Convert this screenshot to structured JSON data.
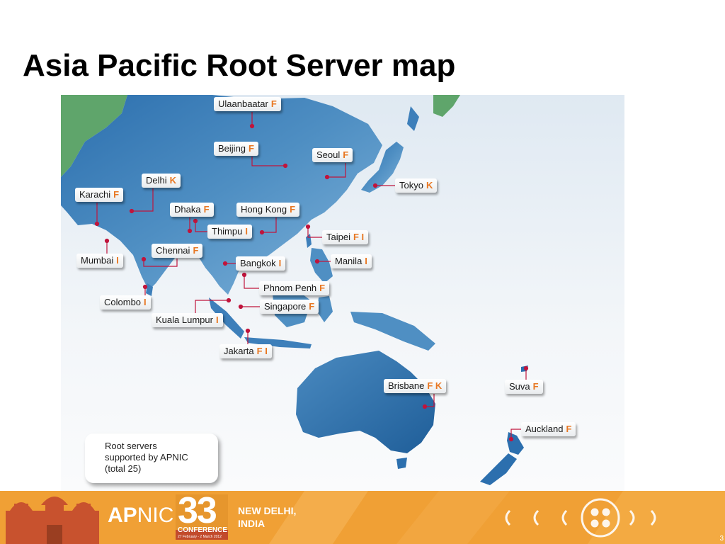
{
  "slide": {
    "title": "Asia Pacific Root Server map",
    "page_number": "3"
  },
  "legend": {
    "lines": [
      "Root servers",
      "supported by APNIC",
      "(total 25)"
    ]
  },
  "cities": [
    {
      "name": "Ulaanbaatar",
      "servers": "F"
    },
    {
      "name": "Beijing",
      "servers": "F"
    },
    {
      "name": "Seoul",
      "servers": "F"
    },
    {
      "name": "Tokyo",
      "servers": "K"
    },
    {
      "name": "Delhi",
      "servers": "K"
    },
    {
      "name": "Karachi",
      "servers": "F"
    },
    {
      "name": "Dhaka",
      "servers": "F"
    },
    {
      "name": "Hong Kong",
      "servers": "F"
    },
    {
      "name": "Thimpu",
      "servers": "I"
    },
    {
      "name": "Taipei",
      "servers": "F I"
    },
    {
      "name": "Chennai",
      "servers": "F"
    },
    {
      "name": "Mumbai",
      "servers": "I"
    },
    {
      "name": "Manila",
      "servers": "I"
    },
    {
      "name": "Bangkok",
      "servers": "I"
    },
    {
      "name": "Phnom Penh",
      "servers": "F"
    },
    {
      "name": "Colombo",
      "servers": "I"
    },
    {
      "name": "Singapore",
      "servers": "F"
    },
    {
      "name": "Kuala Lumpur",
      "servers": "I"
    },
    {
      "name": "Jakarta",
      "servers": "F I"
    },
    {
      "name": "Brisbane",
      "servers": "F K"
    },
    {
      "name": "Suva",
      "servers": "F"
    },
    {
      "name": "Auckland",
      "servers": "F"
    }
  ],
  "footer": {
    "brand_ap": "AP",
    "brand_nic": "NIC",
    "number": "33",
    "conference": "CONFERENCE",
    "dates": "27 February - 2 March 2012",
    "location_line1": "NEW DELHI,",
    "location_line2": "INDIA"
  },
  "colors": {
    "server_letter": "#e87722",
    "ocean_blue": "#4f8fc3",
    "footer_orange": "#f0a035",
    "marker": "#c0143c"
  }
}
